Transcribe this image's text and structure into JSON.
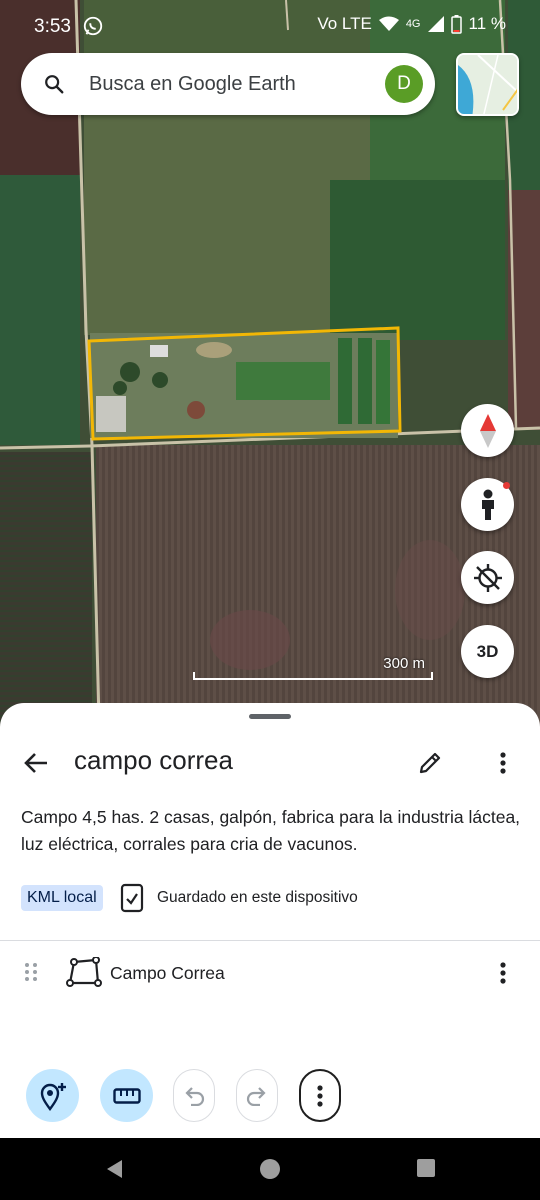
{
  "status": {
    "time": "3:53",
    "network": "4G",
    "battery": "11 %",
    "volte": "Vo LTE"
  },
  "search": {
    "placeholder": "Busca en Google Earth",
    "avatar_letter": "D"
  },
  "map": {
    "scale_label": "300 m",
    "button_3d": "3D"
  },
  "sheet": {
    "title": "campo correa",
    "description": "Campo 4,5 has. 2 casas, galpón, fabrica para la industria láctea, luz eléctrica, corrales para cria de vacunos.",
    "badge": "KML local",
    "saved_text": "Guardado en este dispositivo",
    "feature_label": "Campo Correa"
  },
  "colors": {
    "accent_blue": "#c2e7ff",
    "avatar_green": "#5a9d26",
    "polygon_yellow": "#f2b705"
  },
  "icons": [
    "search-icon",
    "layers-icon",
    "compass-icon",
    "street-view-icon",
    "location-off-icon",
    "back-arrow-icon",
    "edit-pencil-icon",
    "more-vert-icon",
    "saved-device-icon",
    "drag-handle-icon",
    "polygon-icon",
    "add-place-icon",
    "ruler-icon",
    "undo-icon",
    "redo-icon",
    "back-nav-icon",
    "home-nav-icon",
    "recents-nav-icon"
  ]
}
